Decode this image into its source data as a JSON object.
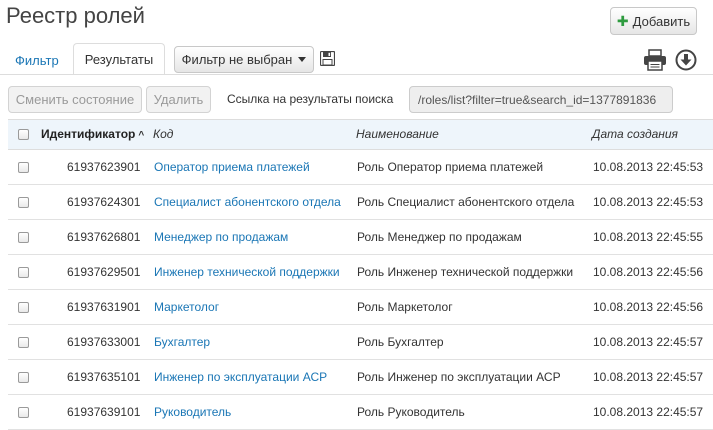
{
  "page": {
    "title": "Реестр ролей",
    "add_button": "Добавить"
  },
  "tabs": {
    "filter": "Фильтр",
    "results": "Результаты"
  },
  "toolbar": {
    "filter_select": "Фильтр не выбран",
    "change_state": "Сменить состояние",
    "delete": "Удалить",
    "link_label": "Ссылка на результаты поиска",
    "link_value": "/roles/list?filter=true&search_id=1377891836"
  },
  "table": {
    "headers": {
      "id": "Идентификатор",
      "code": "Код",
      "name": "Наименование",
      "created": "Дата создания"
    },
    "rows": [
      {
        "id": "61937623901",
        "code": "Оператор приема платежей",
        "name": "Роль Оператор приема платежей",
        "created": "10.08.2013 22:45:53"
      },
      {
        "id": "61937624301",
        "code": "Специалист абонентского отдела",
        "name": "Роль Специалист абонентского отдела",
        "created": "10.08.2013 22:45:53"
      },
      {
        "id": "61937626801",
        "code": "Менеджер по продажам",
        "name": "Роль Менеджер по продажам",
        "created": "10.08.2013 22:45:55"
      },
      {
        "id": "61937629501",
        "code": "Инженер технической поддержки",
        "name": "Роль Инженер технической поддержки",
        "created": "10.08.2013 22:45:56"
      },
      {
        "id": "61937631901",
        "code": "Маркетолог",
        "name": "Роль Маркетолог",
        "created": "10.08.2013 22:45:56"
      },
      {
        "id": "61937633001",
        "code": "Бухгалтер",
        "name": "Роль Бухгалтер",
        "created": "10.08.2013 22:45:57"
      },
      {
        "id": "61937635101",
        "code": "Инженер по эксплуатации АСР",
        "name": "Роль Инженер по эксплуатации АСР",
        "created": "10.08.2013 22:45:57"
      },
      {
        "id": "61937639101",
        "code": "Руководитель",
        "name": "Роль Руководитель",
        "created": "10.08.2013 22:45:57"
      }
    ]
  },
  "icons": {
    "save": "floppy-disk",
    "print": "printer",
    "download": "arrow-down-circle",
    "sort": "sort-ascending"
  },
  "colors": {
    "link": "#1a76b5",
    "add_plus": "#2e9b3f",
    "header_bg": "#eef5fb"
  }
}
